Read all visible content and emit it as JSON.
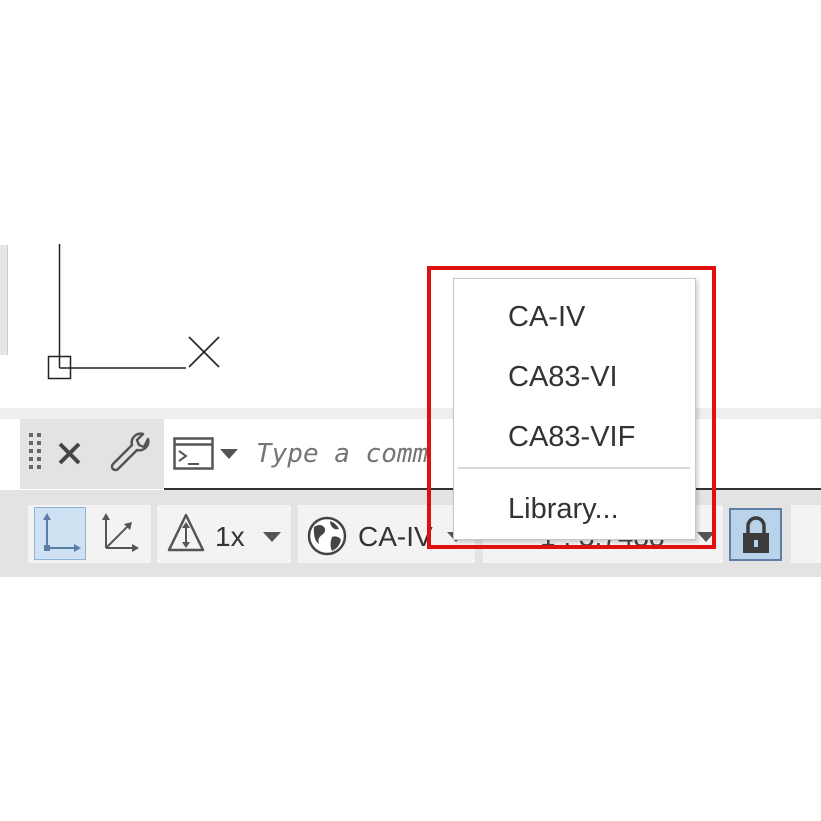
{
  "command_line": {
    "placeholder": "Type a comm"
  },
  "status_bar": {
    "annotation_scale": "1x",
    "coordinate_system": "CA-IV",
    "partial_text": "1 . 3.7488"
  },
  "coordinate_menu": {
    "items": [
      "CA-IV",
      "CA83-VI",
      "CA83-VIF"
    ],
    "library_label": "Library..."
  },
  "colors": {
    "highlight_border": "#e01010",
    "active_button_bg": "#cfe2f3",
    "lock_button_bg": "#b9d3ea"
  },
  "icons": {
    "grip": "grip-dots-icon",
    "close": "close-icon",
    "customize": "wrench-icon",
    "command_history": "terminal-icon",
    "history_dropdown": "caret-down-icon",
    "ortho": "ortho-axes-icon",
    "isodraft": "isometric-axes-icon",
    "annotation": "annotation-scale-icon",
    "globe": "globe-icon",
    "lock": "lock-icon",
    "ucs": "ucs-icon",
    "cursor": "crosshair-x-icon"
  }
}
